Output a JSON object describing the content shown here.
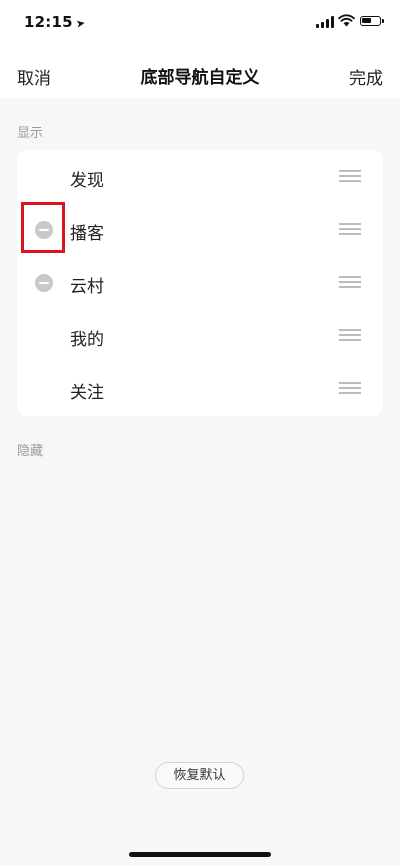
{
  "status_bar": {
    "time": "12:15",
    "location_icon": "location-arrow-icon",
    "battery_level": 0.6
  },
  "nav": {
    "cancel_label": "取消",
    "title": "底部导航自定义",
    "done_label": "完成"
  },
  "visible_section": {
    "label": "显示",
    "items": [
      {
        "label": "发现",
        "removable": false
      },
      {
        "label": "播客",
        "removable": true,
        "highlighted": true
      },
      {
        "label": "云村",
        "removable": true
      },
      {
        "label": "我的",
        "removable": false
      },
      {
        "label": "关注",
        "removable": false
      }
    ]
  },
  "hidden_section": {
    "label": "隐藏"
  },
  "restore_button_label": "恢复默认",
  "colors": {
    "highlight": "#d9161c",
    "remove_icon": "#c9c9c9",
    "background": "#f7f7f7"
  }
}
